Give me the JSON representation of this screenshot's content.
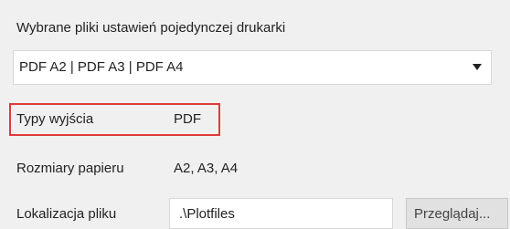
{
  "section": {
    "title": "Wybrane pliki ustawień pojedynczej drukarki"
  },
  "settings_files": {
    "selected": "PDF A2 | PDF A3 | PDF A4",
    "icon": "chevron-down-icon"
  },
  "output_type": {
    "label": "Typy wyjścia",
    "value": "PDF",
    "highlight_color": "#e03a3a"
  },
  "paper_sizes": {
    "label": "Rozmiary papieru",
    "value": "A2, A3, A4"
  },
  "file_location": {
    "label": "Lokalizacja pliku",
    "value": ".\\Plotfiles",
    "browse_label": "Przeglądaj..."
  }
}
